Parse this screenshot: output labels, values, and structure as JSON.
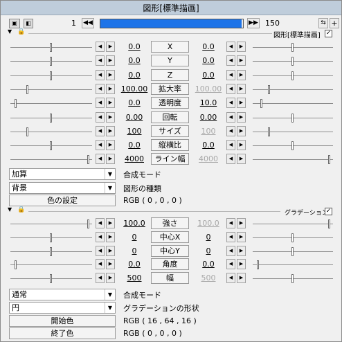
{
  "window": {
    "title": "図形[標準描画]"
  },
  "toolbar": {
    "frame_start": "1",
    "frame_end": "150",
    "progress_fraction": 1.0
  },
  "section1": {
    "name": "図形[標準描画]",
    "checked": true,
    "rows": [
      {
        "left": "0.0",
        "label": "X",
        "right": "0.0",
        "left_fraction": 0.5,
        "right_fraction": 0.5,
        "dim": false
      },
      {
        "left": "0.0",
        "label": "Y",
        "right": "0.0",
        "left_fraction": 0.5,
        "right_fraction": 0.5,
        "dim": false
      },
      {
        "left": "0.0",
        "label": "Z",
        "right": "0.0",
        "left_fraction": 0.5,
        "right_fraction": 0.5,
        "dim": false
      },
      {
        "left": "100.00",
        "label": "拡大率",
        "right": "100.00",
        "left_fraction": 0.2,
        "right_fraction": 0.2,
        "dim": true
      },
      {
        "left": "0.0",
        "label": "透明度",
        "right": "10.0",
        "left_fraction": 0.05,
        "right_fraction": 0.1,
        "dim": false
      },
      {
        "left": "0.00",
        "label": "回転",
        "right": "0.00",
        "left_fraction": 0.5,
        "right_fraction": 0.5,
        "dim": false
      },
      {
        "left": "100",
        "label": "サイズ",
        "right": "100",
        "left_fraction": 0.2,
        "right_fraction": 0.2,
        "dim": true
      },
      {
        "left": "0.0",
        "label": "縦横比",
        "right": "0.0",
        "left_fraction": 0.5,
        "right_fraction": 0.5,
        "dim": false
      },
      {
        "left": "4000",
        "label": "ライン幅",
        "right": "4000",
        "left_fraction": 0.97,
        "right_fraction": 0.97,
        "dim": true
      }
    ],
    "blend_value": "加算",
    "blend_label": "合成モード",
    "shape_value": "背景",
    "shape_label": "図形の種類",
    "color_button": "色の設定",
    "color_value": "RGB ( 0 , 0 , 0 )"
  },
  "section2": {
    "name": "グラデーション",
    "checked": true,
    "rows": [
      {
        "left": "100.0",
        "label": "強さ",
        "right": "100.0",
        "left_fraction": 0.97,
        "right_fraction": 0.97,
        "dim": true
      },
      {
        "left": "0",
        "label": "中心X",
        "right": "0",
        "left_fraction": 0.5,
        "right_fraction": 0.5,
        "dim": false
      },
      {
        "left": "0",
        "label": "中心Y",
        "right": "0",
        "left_fraction": 0.5,
        "right_fraction": 0.5,
        "dim": false
      },
      {
        "left": "0.0",
        "label": "角度",
        "right": "0.0",
        "left_fraction": 0.05,
        "right_fraction": 0.05,
        "dim": false
      },
      {
        "left": "500",
        "label": "幅",
        "right": "500",
        "left_fraction": 0.5,
        "right_fraction": 0.5,
        "dim": true
      }
    ],
    "blend_value": "通常",
    "blend_label": "合成モード",
    "shape_value": "円",
    "shape_label": "グラデーションの形状",
    "start_button": "開始色",
    "start_value": "RGB ( 16 , 64 , 16 )",
    "end_button": "終了色",
    "end_value": "RGB ( 0 , 0 , 0 )"
  }
}
